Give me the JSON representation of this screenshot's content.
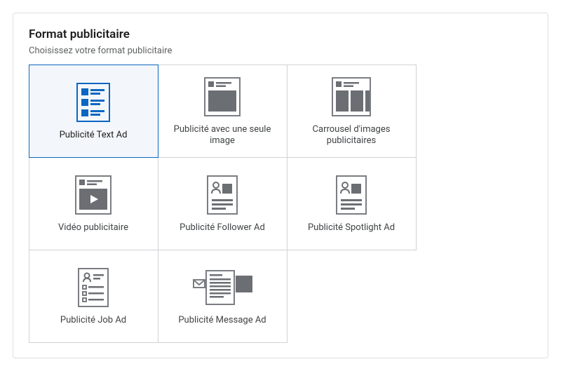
{
  "section": {
    "title": "Format publicitaire",
    "subtitle": "Choisissez votre format publicitaire"
  },
  "formats": [
    {
      "label": "Publicité Text Ad",
      "icon": "text-ad-icon",
      "selected": true
    },
    {
      "label": "Publicité avec une seule image",
      "icon": "single-image-ad-icon",
      "selected": false
    },
    {
      "label": "Carrousel d'images publicitaires",
      "icon": "carousel-ad-icon",
      "selected": false
    },
    {
      "label": "Vidéo publicitaire",
      "icon": "video-ad-icon",
      "selected": false
    },
    {
      "label": "Publicité Follower Ad",
      "icon": "follower-ad-icon",
      "selected": false
    },
    {
      "label": "Publicité Spotlight Ad",
      "icon": "spotlight-ad-icon",
      "selected": false
    },
    {
      "label": "Publicité Job Ad",
      "icon": "job-ad-icon",
      "selected": false
    },
    {
      "label": "Publicité Message Ad",
      "icon": "message-ad-icon",
      "selected": false
    }
  ],
  "colors": {
    "accent": "#0a66c2",
    "iconGray": "#6b6e73",
    "iconBorder": "#7a7d82"
  }
}
